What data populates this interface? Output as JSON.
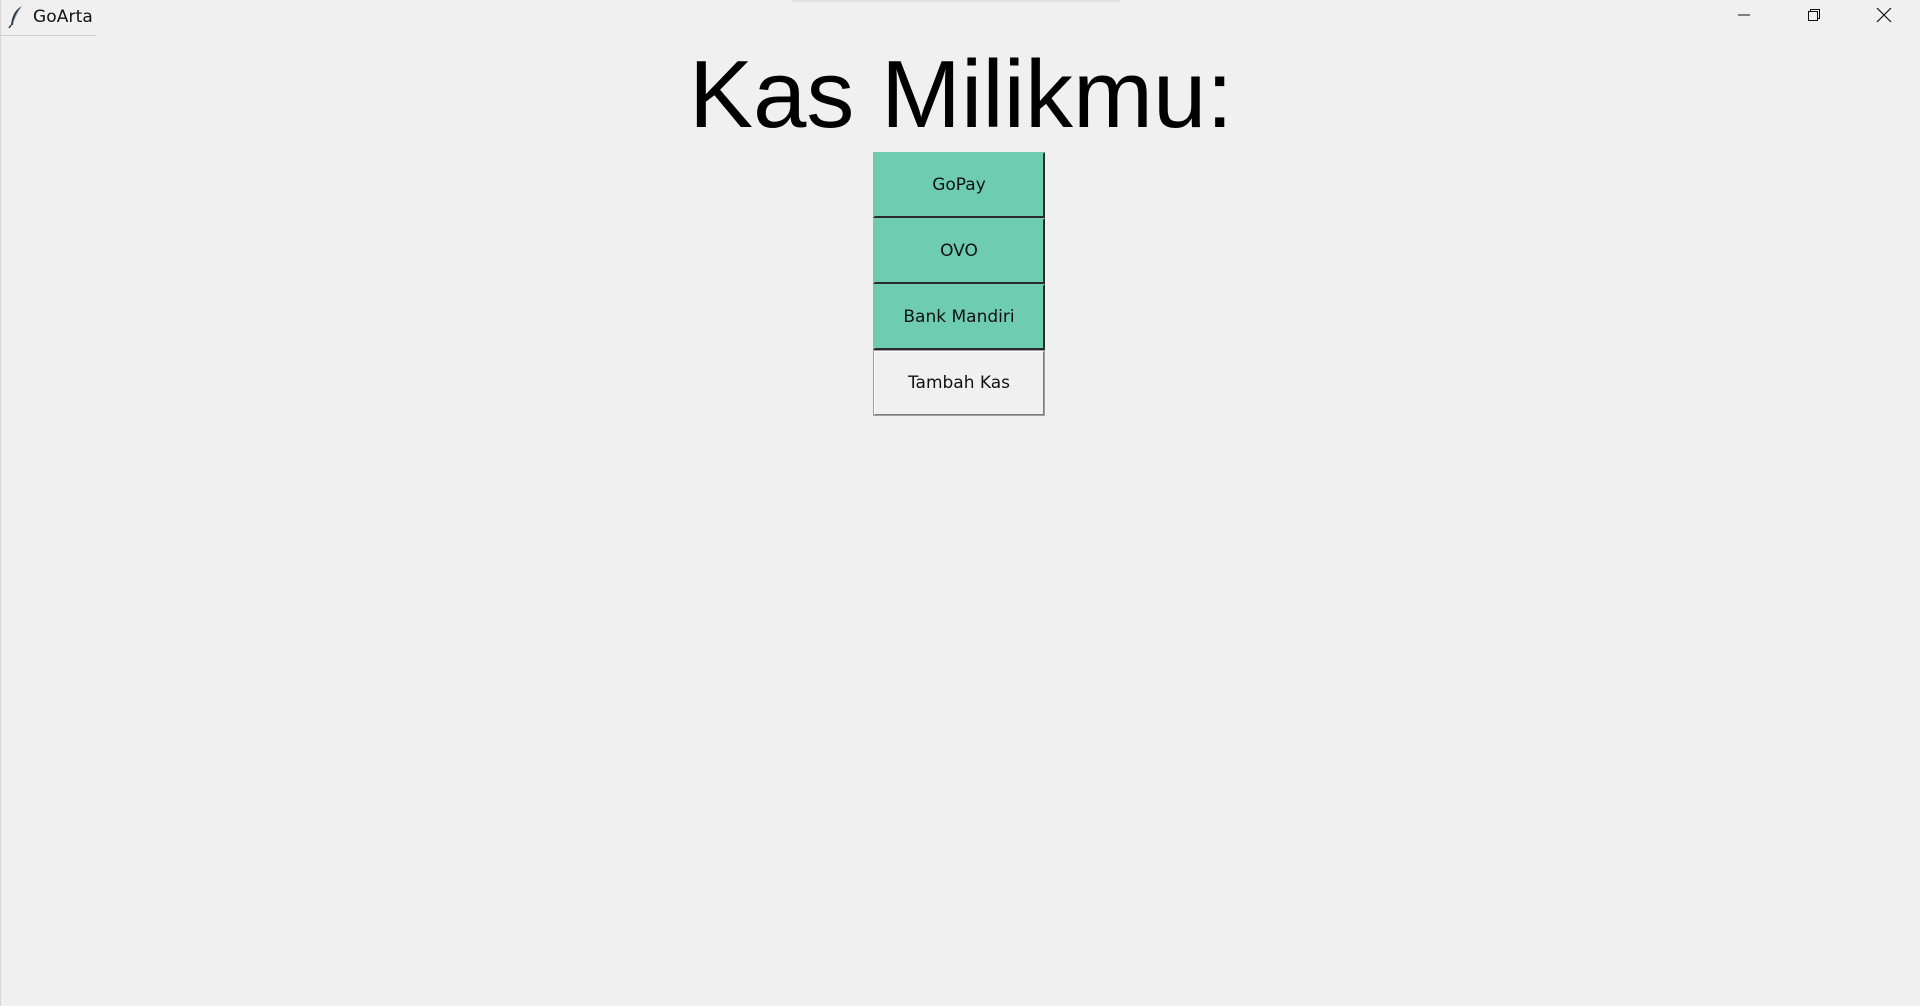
{
  "window": {
    "title": "GoArta",
    "icon": "feather-icon",
    "controls": [
      "minimize-icon",
      "restore-icon",
      "close-icon"
    ]
  },
  "main": {
    "heading": "Kas Milikmu:",
    "accounts": [
      {
        "label": "GoPay"
      },
      {
        "label": "OVO"
      },
      {
        "label": "Bank Mandiri"
      }
    ],
    "add_button": "Tambah Kas"
  },
  "colors": {
    "account_button": "#6ecdb0",
    "background": "#f0f0f0"
  }
}
